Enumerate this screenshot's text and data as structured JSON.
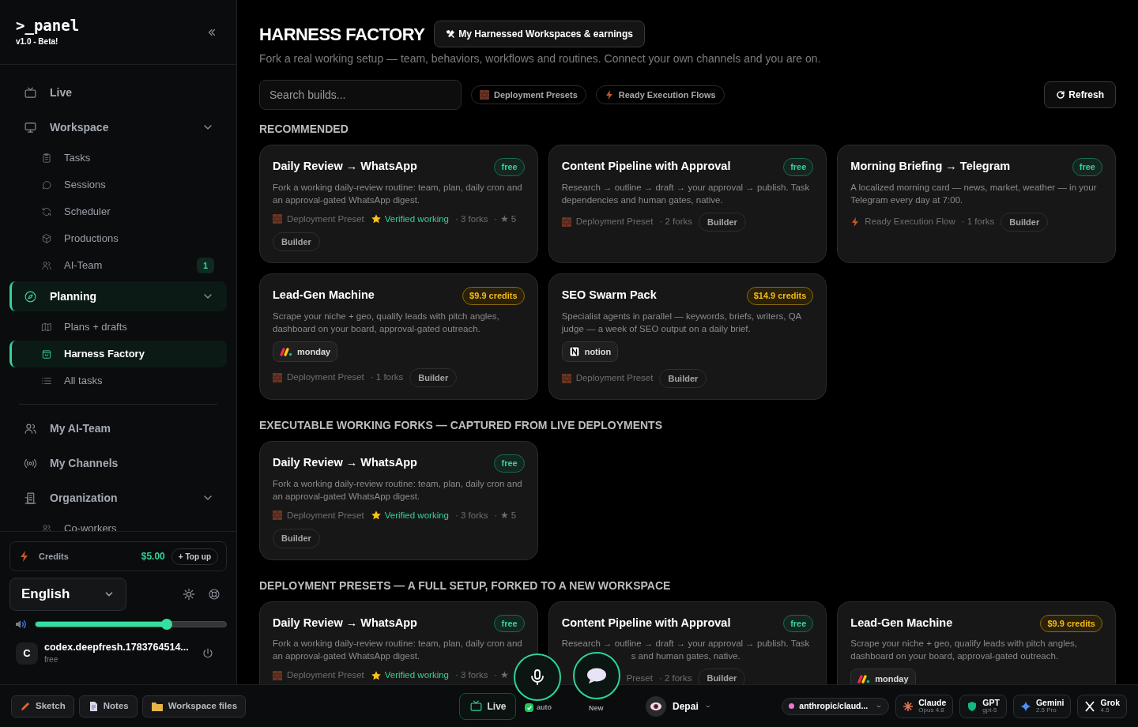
{
  "sidebar": {
    "logo": ">_panel",
    "version": "v1.0 - Beta!",
    "nav": [
      {
        "label": "Live",
        "selected": false
      },
      {
        "label": "Workspace",
        "selected": false,
        "expanded": true,
        "children": [
          {
            "label": "Tasks",
            "selected": false
          },
          {
            "label": "Sessions",
            "selected": false
          },
          {
            "label": "Scheduler",
            "selected": false
          },
          {
            "label": "Productions",
            "selected": false
          },
          {
            "label": "AI-Team",
            "selected": false,
            "badge": "1"
          }
        ]
      },
      {
        "label": "Planning",
        "selected": true,
        "expanded": true,
        "children": [
          {
            "label": "Plans + drafts",
            "selected": false
          },
          {
            "label": "Harness Factory",
            "selected": true
          },
          {
            "label": "All tasks",
            "selected": false
          }
        ]
      }
    ],
    "nav_more": [
      {
        "label": "My AI-Team",
        "selected": false
      },
      {
        "label": "My Channels",
        "selected": false
      },
      {
        "label": "Organization",
        "selected": false,
        "expanded": true,
        "children": [
          {
            "label": "Co-workers",
            "selected": false
          }
        ]
      }
    ],
    "credits": {
      "label": "Credits",
      "amount": "$5.00",
      "action": "+ Top up"
    },
    "language": "English",
    "volume": {
      "level": 0.69
    },
    "user": {
      "initial": "C",
      "name": "codex.deepfresh.1783764514...",
      "plan": "free"
    }
  },
  "main": {
    "title": "HARNESS FACTORY",
    "earnings_button": "My Harnessed Workspaces & earnings",
    "subtitle": "Fork a real working setup — team, behaviors, workflows and routines. Connect your own channels and you are on.",
    "search": {
      "placeholder": "Search builds..."
    },
    "filters": [
      {
        "label": "Deployment Presets",
        "kind": "preset",
        "selected": false
      },
      {
        "label": "Ready Execution Flows",
        "kind": "flow",
        "selected": false
      }
    ],
    "refresh": "Refresh",
    "sections": [
      {
        "title": "RECOMMENDED",
        "cards": [
          {
            "title": "Daily Review → WhatsApp",
            "price": "free",
            "paid": false,
            "description": "Fork a working daily-review routine: team, plan, daily cron and an approval-gated WhatsApp digest.",
            "type": {
              "label": "Deployment Preset",
              "kind": "preset"
            },
            "verified": "Verified working",
            "forks": "· 3 forks",
            "rating": "· ★ 5",
            "tag": "Builder"
          },
          {
            "title": "Content Pipeline with Approval",
            "price": "free",
            "paid": false,
            "description": "Research → outline → draft → your approval → publish. Task dependencies and human gates, native.",
            "type": {
              "label": "Deployment Preset",
              "kind": "preset"
            },
            "forks": "· 2 forks",
            "tag": "Builder"
          },
          {
            "title": "Morning Briefing → Telegram",
            "price": "free",
            "paid": false,
            "description": "A localized morning card — news, market, weather — in your Telegram every day at 7:00.",
            "type": {
              "label": "Ready Execution Flow",
              "kind": "flow"
            },
            "forks": "· 1 forks",
            "tag": "Builder"
          },
          {
            "title": "Lead-Gen Machine",
            "price": "$9.9 credits",
            "paid": true,
            "description": "Scrape your niche + geo, qualify leads with pitch angles, dashboard on your board, approval-gated outreach.",
            "integration": {
              "label": "monday",
              "kind": "dots"
            },
            "type": {
              "label": "Deployment Preset",
              "kind": "preset"
            },
            "forks": "· 1 forks",
            "tag": "Builder"
          },
          {
            "title": "SEO Swarm Pack",
            "price": "$14.9 credits",
            "paid": true,
            "description": "Specialist agents in parallel — keywords, briefs, writers, QA judge — a week of SEO output on a daily brief.",
            "integration": {
              "label": "notion",
              "kind": "square"
            },
            "type": {
              "label": "Deployment Preset",
              "kind": "preset"
            },
            "tag": "Builder"
          }
        ]
      },
      {
        "title": "EXECUTABLE WORKING FORKS — CAPTURED FROM LIVE DEPLOYMENTS",
        "cards": [
          {
            "title": "Daily Review → WhatsApp",
            "price": "free",
            "paid": false,
            "description": "Fork a working daily-review routine: team, plan, daily cron and an approval-gated WhatsApp digest.",
            "type": {
              "label": "Deployment Preset",
              "kind": "preset"
            },
            "verified": "Verified working",
            "forks": "· 3 forks",
            "rating": "· ★ 5",
            "tag": "Builder"
          }
        ]
      },
      {
        "title": "DEPLOYMENT PRESETS — A FULL SETUP, FORKED TO A NEW WORKSPACE",
        "cards": [
          {
            "title": "Daily Review → WhatsApp",
            "price": "free",
            "paid": false,
            "description": "Fork a working daily-review routine: team, plan, daily cron and an approval-gated WhatsApp digest.",
            "type": {
              "label": "Deployment Preset",
              "kind": "preset"
            },
            "verified": "Verified working",
            "forks": "· 3 forks",
            "rating": "· ★"
          },
          {
            "title": "Content Pipeline with Approval",
            "price": "free",
            "paid": false,
            "kind": "partly_covered",
            "description": "Research → outline → draft → your approval → publish. Task",
            "description_rest": "s and human gates, native.",
            "type": {
              "label": "Preset"
            },
            "forks": "· 2 forks",
            "tag": "Builder"
          },
          {
            "title": "Lead-Gen Machine",
            "price": "$9.9 credits",
            "paid": true,
            "description": "Scrape your niche + geo, qualify leads with pitch angles, dashboard on your board, approval-gated outreach.",
            "integration": {
              "label": "monday",
              "kind": "dots"
            }
          }
        ]
      }
    ]
  },
  "bottom_bar": {
    "tools": [
      {
        "label": "Sketch"
      },
      {
        "label": "Notes"
      },
      {
        "label": "Workspace files"
      }
    ],
    "live": "Live",
    "mic": {
      "label": "auto",
      "checked": true
    },
    "new": "New",
    "agent": {
      "name": "Depai"
    },
    "model_select": "anthropic/claud...",
    "models": [
      {
        "name": "Claude",
        "version": "Opus 4.8"
      },
      {
        "name": "GPT",
        "version": "gpt-5"
      },
      {
        "name": "Gemini",
        "version": "2.5 Pro"
      },
      {
        "name": "Grok",
        "version": "4.5"
      }
    ]
  }
}
